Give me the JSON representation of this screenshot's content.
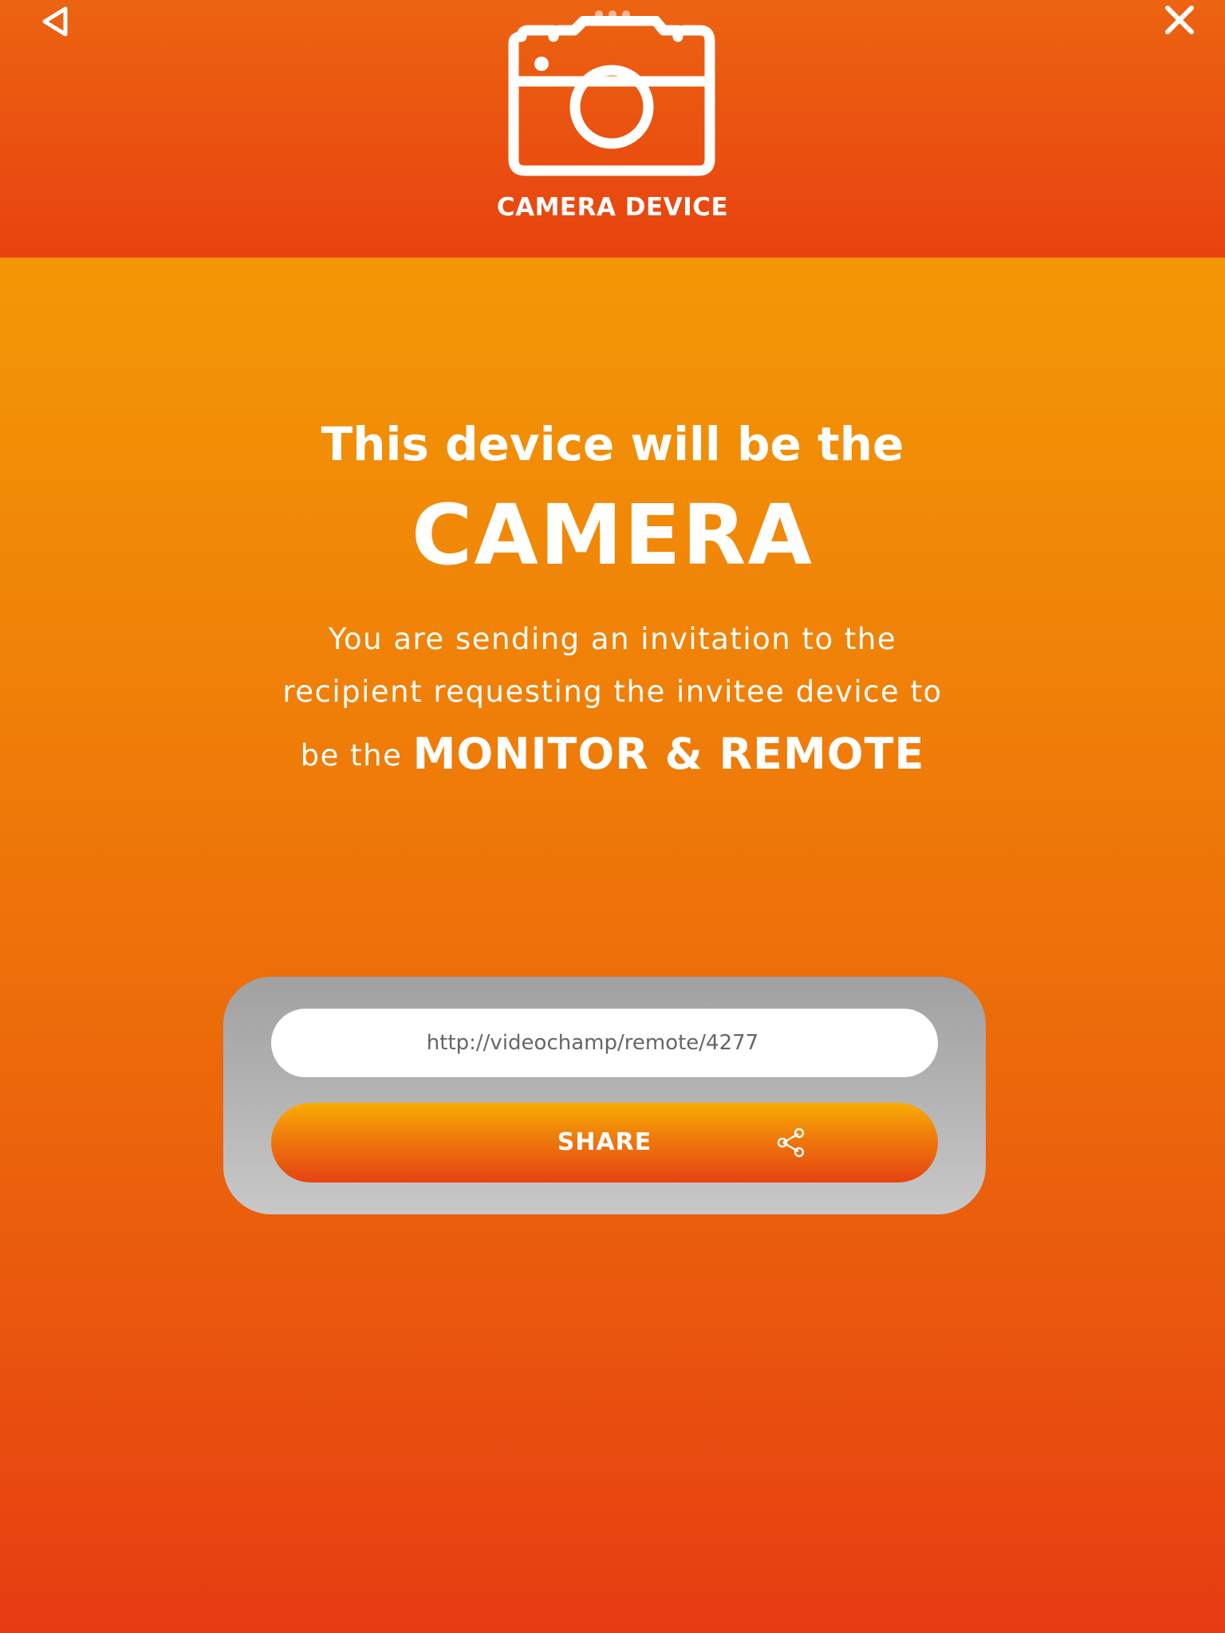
{
  "header": {
    "title": "CAMERA DEVICE",
    "icons": {
      "back": "back-triangle-icon",
      "close": "close-icon",
      "device": "camera-icon"
    }
  },
  "main": {
    "lead": "This device will be the",
    "role": "CAMERA",
    "description": {
      "line1": "You are sending an invitation to the",
      "line2": "recipient requesting the invitee device to",
      "line3_prefix": "be the",
      "line3_role": "MONITOR & REMOTE"
    }
  },
  "share_card": {
    "url": "http://videochamp/remote/4277",
    "share_label": "SHARE",
    "share_icon": "share-icon"
  },
  "colors": {
    "header": "#e8420f",
    "background_top": "#f6a304",
    "background_bottom": "#e63c12",
    "card": "#b3b3b3",
    "text": "#ffffff"
  }
}
